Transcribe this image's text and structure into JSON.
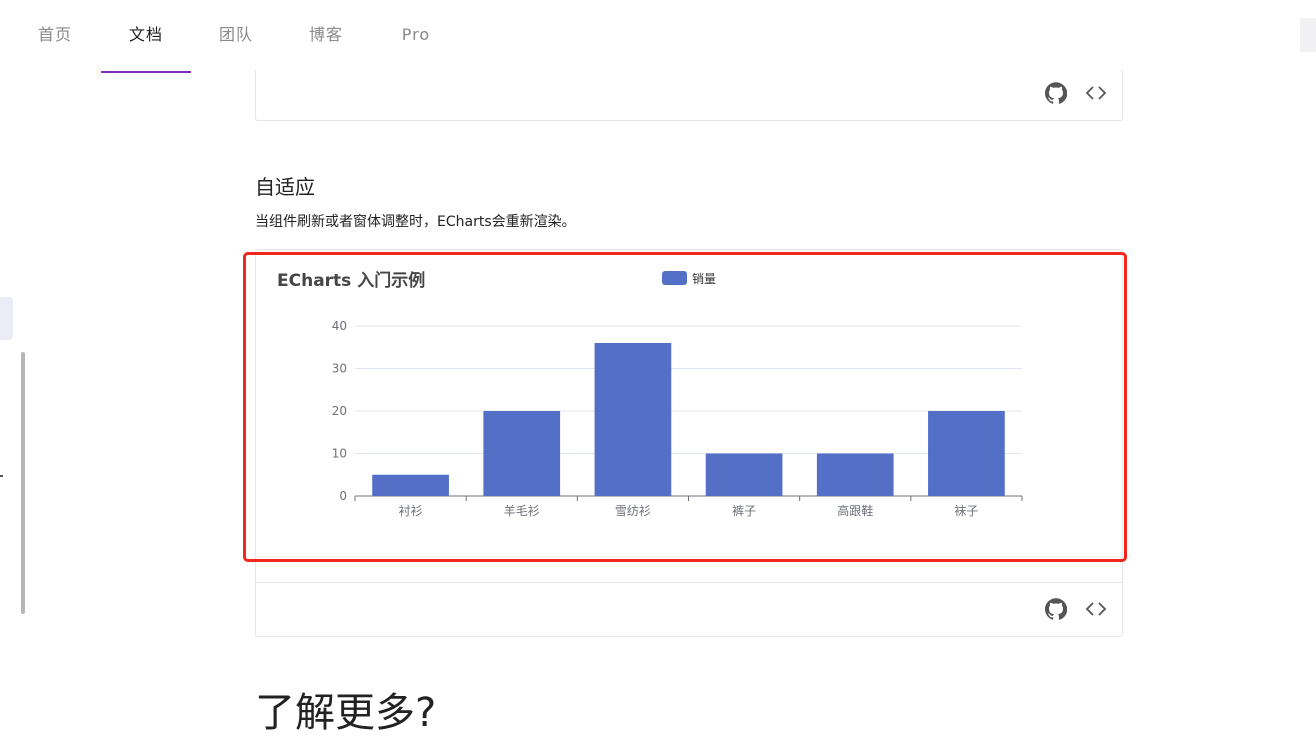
{
  "nav": {
    "tabs": [
      {
        "label": "首页"
      },
      {
        "label": "文档"
      },
      {
        "label": "团队"
      },
      {
        "label": "博客"
      },
      {
        "label": "Pro"
      }
    ],
    "active_index": 1
  },
  "section": {
    "title": "自适应",
    "description": "当组件刷新或者窗体调整时，ECharts会重新渲染。"
  },
  "icons": {
    "github": "github-icon",
    "code": "code-icon"
  },
  "colors": {
    "nav_active_underline": "#7b2fb8",
    "bar": "#5470c6",
    "highlight": "#f0271c"
  },
  "next_heading": "了解更多?",
  "chart_data": {
    "type": "bar",
    "title": "ECharts 入门示例",
    "legend": [
      "销量"
    ],
    "legend_position": "top-center",
    "categories": [
      "衬衫",
      "羊毛衫",
      "雪纺衫",
      "裤子",
      "高跟鞋",
      "袜子"
    ],
    "series": [
      {
        "name": "销量",
        "values": [
          5,
          20,
          36,
          10,
          10,
          20
        ]
      }
    ],
    "ylim": [
      0,
      40
    ],
    "yticks": [
      0,
      10,
      20,
      30,
      40
    ],
    "grid": true
  }
}
